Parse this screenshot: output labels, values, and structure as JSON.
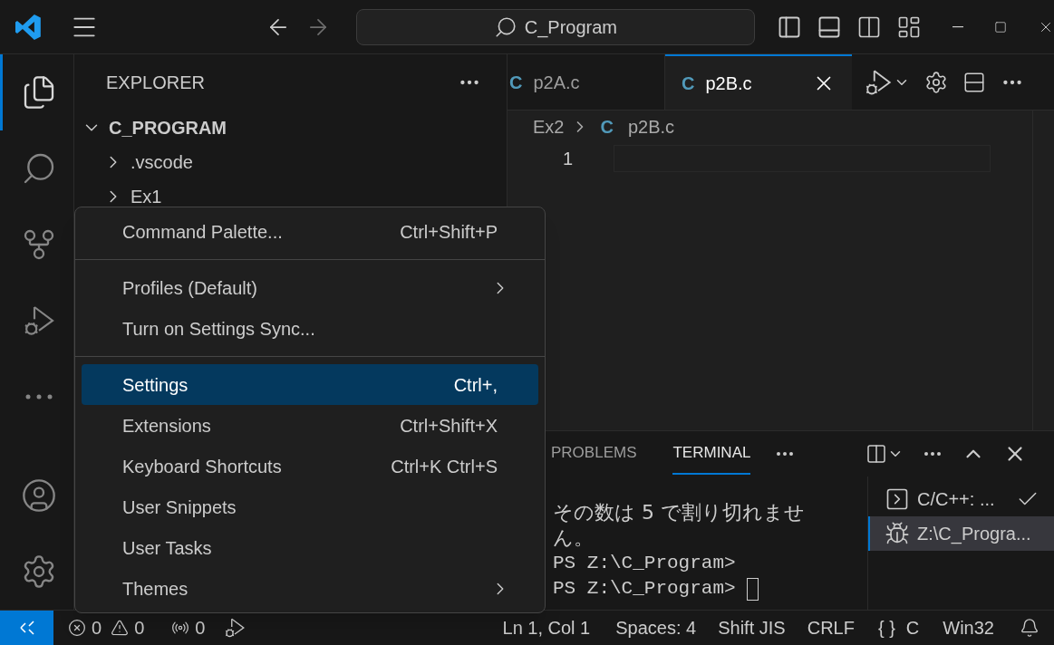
{
  "title_bar": {
    "search": "C_Program"
  },
  "activity_bar": {
    "top": [
      {
        "kind": "explorer",
        "selected": true
      },
      {
        "kind": "search",
        "selected": false
      },
      {
        "kind": "source-control",
        "selected": false
      },
      {
        "kind": "run-debug",
        "selected": false
      },
      {
        "kind": "more",
        "selected": false
      }
    ],
    "bottom": [
      {
        "kind": "account",
        "selected": false
      },
      {
        "kind": "manage",
        "selected": false
      }
    ]
  },
  "sidebar": {
    "title": "EXPLORER",
    "root": {
      "label": "C_PROGRAM",
      "expanded": true,
      "children": [
        {
          "label": ".vscode",
          "expanded": false
        },
        {
          "label": "Ex1",
          "expanded": false
        }
      ]
    }
  },
  "editor": {
    "tabs": [
      {
        "label": "p2A.c",
        "icon": "C",
        "selected": false
      },
      {
        "label": "p2B.c",
        "icon": "C",
        "selected": true
      }
    ],
    "breadcrumb": {
      "folder": "Ex2",
      "icon": "C",
      "file": "p2B.c"
    },
    "line_numbers": [
      "1"
    ]
  },
  "panel": {
    "tabs": [
      {
        "label": "PROBLEMS",
        "selected": false
      },
      {
        "label": "TERMINAL",
        "selected": true
      }
    ],
    "terminal_lines": [
      "その数は 5 で割り切れませ",
      "ん。",
      "PS Z:\\C_Program>",
      "PS Z:\\C_Program>"
    ],
    "terminals": [
      {
        "kind": "task",
        "label": "C/C++: ...",
        "succeeded": true,
        "selected": false
      },
      {
        "kind": "debug",
        "label": "Z:\\C_Progra...",
        "succeeded": false,
        "selected": true
      }
    ]
  },
  "menu": [
    {
      "kind": "item",
      "label": "Command Palette...",
      "shortcut": "Ctrl+Shift+P",
      "selected": false
    },
    {
      "kind": "separator"
    },
    {
      "kind": "submenu",
      "label": "Profiles (Default)",
      "selected": false
    },
    {
      "kind": "item",
      "label": "Turn on Settings Sync...",
      "selected": false
    },
    {
      "kind": "separator"
    },
    {
      "kind": "item",
      "label": "Settings",
      "shortcut": "Ctrl+,",
      "selected": true
    },
    {
      "kind": "item",
      "label": "Extensions",
      "shortcut": "Ctrl+Shift+X",
      "selected": false
    },
    {
      "kind": "item",
      "label": "Keyboard Shortcuts",
      "shortcut": "Ctrl+K Ctrl+S",
      "selected": false
    },
    {
      "kind": "item",
      "label": "User Snippets",
      "selected": false
    },
    {
      "kind": "item",
      "label": "User Tasks",
      "selected": false
    },
    {
      "kind": "submenu",
      "label": "Themes",
      "selected": false
    }
  ],
  "status_bar": {
    "errors": "0",
    "warnings": "0",
    "ports": "0",
    "position": "Ln 1, Col 1",
    "spaces": "Spaces: 4",
    "encoding": "Shift JIS",
    "eol": "CRLF",
    "braces": "{ }",
    "language": "C",
    "platform": "Win32"
  }
}
